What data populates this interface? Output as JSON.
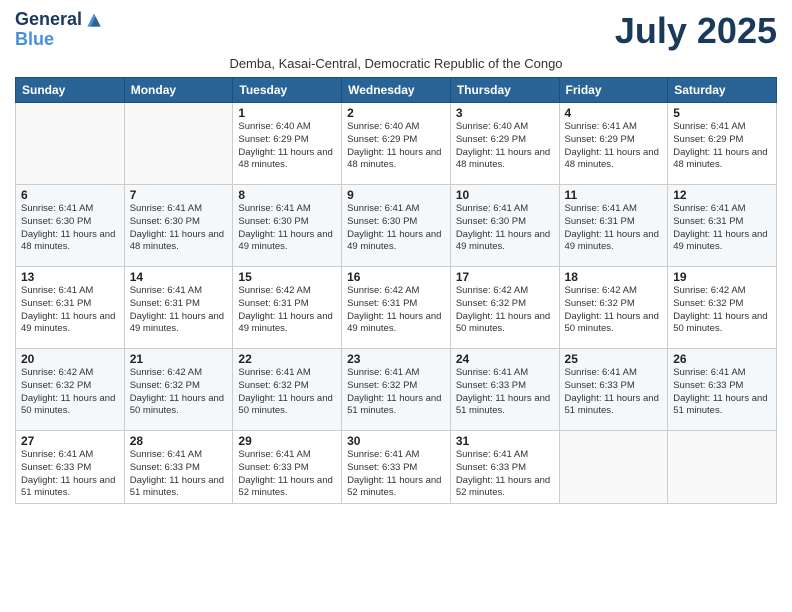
{
  "logo": {
    "line1": "General",
    "line2": "Blue"
  },
  "title": "July 2025",
  "subtitle": "Demba, Kasai-Central, Democratic Republic of the Congo",
  "days_of_week": [
    "Sunday",
    "Monday",
    "Tuesday",
    "Wednesday",
    "Thursday",
    "Friday",
    "Saturday"
  ],
  "weeks": [
    [
      {
        "day": "",
        "info": ""
      },
      {
        "day": "",
        "info": ""
      },
      {
        "day": "1",
        "info": "Sunrise: 6:40 AM\nSunset: 6:29 PM\nDaylight: 11 hours and 48 minutes."
      },
      {
        "day": "2",
        "info": "Sunrise: 6:40 AM\nSunset: 6:29 PM\nDaylight: 11 hours and 48 minutes."
      },
      {
        "day": "3",
        "info": "Sunrise: 6:40 AM\nSunset: 6:29 PM\nDaylight: 11 hours and 48 minutes."
      },
      {
        "day": "4",
        "info": "Sunrise: 6:41 AM\nSunset: 6:29 PM\nDaylight: 11 hours and 48 minutes."
      },
      {
        "day": "5",
        "info": "Sunrise: 6:41 AM\nSunset: 6:29 PM\nDaylight: 11 hours and 48 minutes."
      }
    ],
    [
      {
        "day": "6",
        "info": "Sunrise: 6:41 AM\nSunset: 6:30 PM\nDaylight: 11 hours and 48 minutes."
      },
      {
        "day": "7",
        "info": "Sunrise: 6:41 AM\nSunset: 6:30 PM\nDaylight: 11 hours and 48 minutes."
      },
      {
        "day": "8",
        "info": "Sunrise: 6:41 AM\nSunset: 6:30 PM\nDaylight: 11 hours and 49 minutes."
      },
      {
        "day": "9",
        "info": "Sunrise: 6:41 AM\nSunset: 6:30 PM\nDaylight: 11 hours and 49 minutes."
      },
      {
        "day": "10",
        "info": "Sunrise: 6:41 AM\nSunset: 6:30 PM\nDaylight: 11 hours and 49 minutes."
      },
      {
        "day": "11",
        "info": "Sunrise: 6:41 AM\nSunset: 6:31 PM\nDaylight: 11 hours and 49 minutes."
      },
      {
        "day": "12",
        "info": "Sunrise: 6:41 AM\nSunset: 6:31 PM\nDaylight: 11 hours and 49 minutes."
      }
    ],
    [
      {
        "day": "13",
        "info": "Sunrise: 6:41 AM\nSunset: 6:31 PM\nDaylight: 11 hours and 49 minutes."
      },
      {
        "day": "14",
        "info": "Sunrise: 6:41 AM\nSunset: 6:31 PM\nDaylight: 11 hours and 49 minutes."
      },
      {
        "day": "15",
        "info": "Sunrise: 6:42 AM\nSunset: 6:31 PM\nDaylight: 11 hours and 49 minutes."
      },
      {
        "day": "16",
        "info": "Sunrise: 6:42 AM\nSunset: 6:31 PM\nDaylight: 11 hours and 49 minutes."
      },
      {
        "day": "17",
        "info": "Sunrise: 6:42 AM\nSunset: 6:32 PM\nDaylight: 11 hours and 50 minutes."
      },
      {
        "day": "18",
        "info": "Sunrise: 6:42 AM\nSunset: 6:32 PM\nDaylight: 11 hours and 50 minutes."
      },
      {
        "day": "19",
        "info": "Sunrise: 6:42 AM\nSunset: 6:32 PM\nDaylight: 11 hours and 50 minutes."
      }
    ],
    [
      {
        "day": "20",
        "info": "Sunrise: 6:42 AM\nSunset: 6:32 PM\nDaylight: 11 hours and 50 minutes."
      },
      {
        "day": "21",
        "info": "Sunrise: 6:42 AM\nSunset: 6:32 PM\nDaylight: 11 hours and 50 minutes."
      },
      {
        "day": "22",
        "info": "Sunrise: 6:41 AM\nSunset: 6:32 PM\nDaylight: 11 hours and 50 minutes."
      },
      {
        "day": "23",
        "info": "Sunrise: 6:41 AM\nSunset: 6:32 PM\nDaylight: 11 hours and 51 minutes."
      },
      {
        "day": "24",
        "info": "Sunrise: 6:41 AM\nSunset: 6:33 PM\nDaylight: 11 hours and 51 minutes."
      },
      {
        "day": "25",
        "info": "Sunrise: 6:41 AM\nSunset: 6:33 PM\nDaylight: 11 hours and 51 minutes."
      },
      {
        "day": "26",
        "info": "Sunrise: 6:41 AM\nSunset: 6:33 PM\nDaylight: 11 hours and 51 minutes."
      }
    ],
    [
      {
        "day": "27",
        "info": "Sunrise: 6:41 AM\nSunset: 6:33 PM\nDaylight: 11 hours and 51 minutes."
      },
      {
        "day": "28",
        "info": "Sunrise: 6:41 AM\nSunset: 6:33 PM\nDaylight: 11 hours and 51 minutes."
      },
      {
        "day": "29",
        "info": "Sunrise: 6:41 AM\nSunset: 6:33 PM\nDaylight: 11 hours and 52 minutes."
      },
      {
        "day": "30",
        "info": "Sunrise: 6:41 AM\nSunset: 6:33 PM\nDaylight: 11 hours and 52 minutes."
      },
      {
        "day": "31",
        "info": "Sunrise: 6:41 AM\nSunset: 6:33 PM\nDaylight: 11 hours and 52 minutes."
      },
      {
        "day": "",
        "info": ""
      },
      {
        "day": "",
        "info": ""
      }
    ]
  ]
}
